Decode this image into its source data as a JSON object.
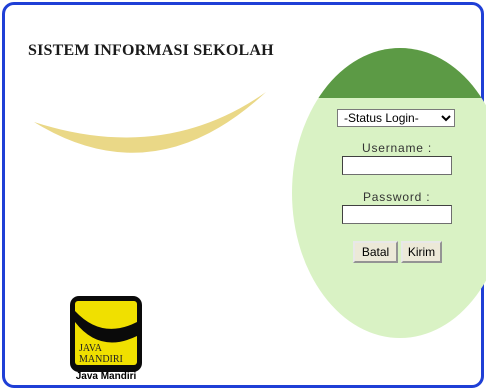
{
  "app": {
    "title": "SISTEM INFORMASI SEKOLAH"
  },
  "login": {
    "status_options": [
      "-Status Login-"
    ],
    "status_selected": "-Status Login-",
    "username_label": "Username :",
    "username_value": "",
    "password_label": "Password :",
    "password_value": "",
    "cancel_label": "Batal",
    "submit_label": "Kirim"
  },
  "logo": {
    "text_line1": "JAVA",
    "text_line2": "MANDIRI",
    "caption": "Java Mandiri"
  },
  "colors": {
    "frame_border": "#1f3fd6",
    "panel_fill": "#d9f2c4",
    "panel_top": "#5c9a45",
    "swoosh": "#ead887",
    "logo_background": "#f0e000"
  }
}
